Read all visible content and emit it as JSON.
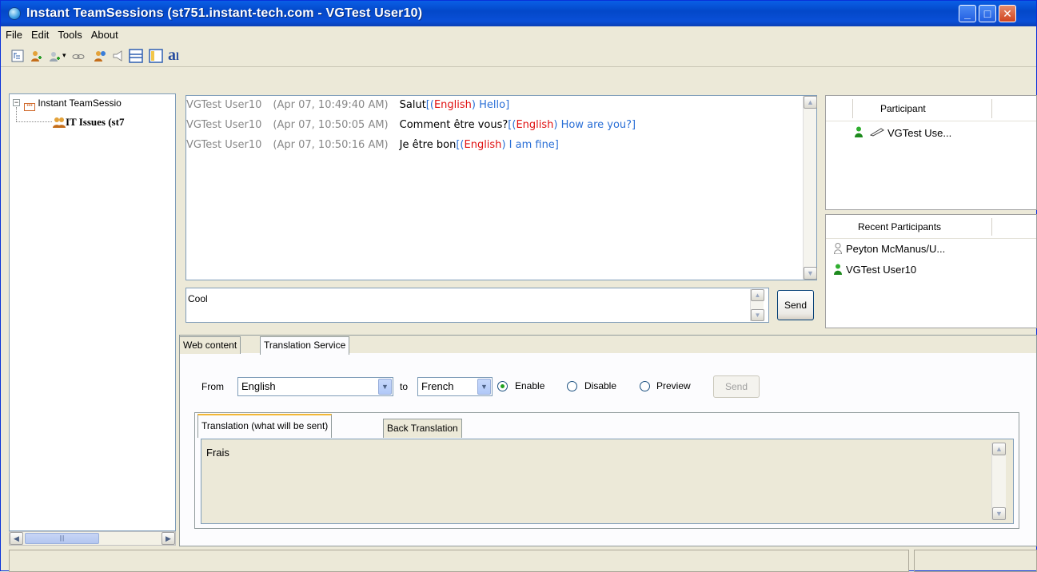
{
  "window": {
    "title": "Instant TeamSessions (st751.instant-tech.com - VGTest User10)"
  },
  "menu": [
    "File",
    "Edit",
    "Tools",
    "About"
  ],
  "tree": {
    "root_label": "Instant TeamSessio",
    "child_label": "IT Issues (st7"
  },
  "chat": {
    "messages": [
      {
        "sender": "VGTest User10",
        "time": "(Apr 07, 10:49:40 AM)",
        "text": "Salut",
        "open": "[(",
        "lang": "English",
        "mid": ")",
        "translation": " Hello]"
      },
      {
        "sender": "VGTest User10",
        "time": "(Apr 07, 10:50:05 AM)",
        "text": "Comment être vous?",
        "open": "[(",
        "lang": "English",
        "mid": ")",
        "translation": " How are you?]"
      },
      {
        "sender": "VGTest User10",
        "time": "(Apr 07, 10:50:16 AM)",
        "text": "Je être bon",
        "open": "[(",
        "lang": "English",
        "mid": ")",
        "translation": " I am fine]"
      }
    ],
    "input_value": "Cool",
    "send_label": "Send"
  },
  "participants": {
    "header": "Participant",
    "items": [
      "VGTest Use..."
    ]
  },
  "recent": {
    "header": "Recent Participants",
    "items": [
      "Peyton McManus/U...",
      "VGTest User10"
    ]
  },
  "tabs": {
    "web_content": "Web content",
    "translation_service": "Translation Service"
  },
  "translation": {
    "from_label": "From",
    "from_value": "English",
    "to_label": "to",
    "to_value": "French",
    "enable_label": "Enable",
    "disable_label": "Disable",
    "preview_label": "Preview",
    "send_label": "Send",
    "selected_mode": "Enable",
    "subtab_sent": "Translation (what will be sent)",
    "subtab_back": "Back Translation",
    "text": "Frais"
  },
  "icons": {
    "app": "globe-icon",
    "online_person": "green-person-icon",
    "offline_person": "gray-person-icon"
  },
  "colors": {
    "titlebar": "#0348c9",
    "lang_red": "#e01010",
    "translation_blue": "#2a6fd6",
    "timestamp_gray": "#888888"
  }
}
